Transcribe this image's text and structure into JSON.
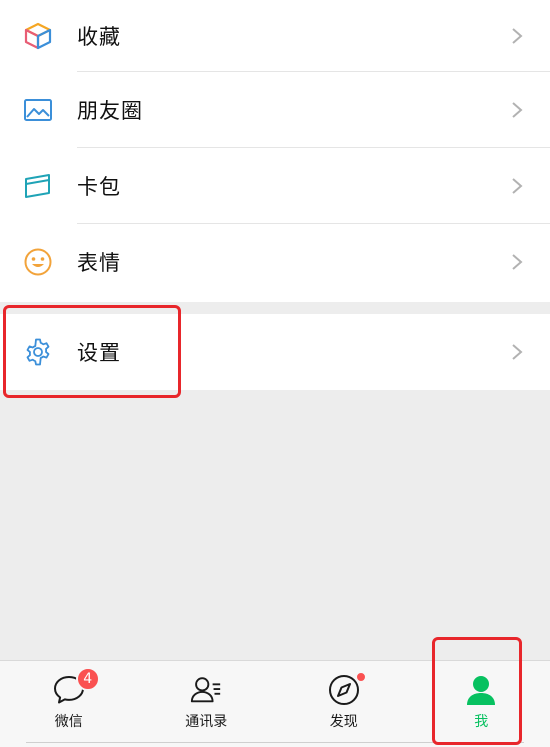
{
  "menu": {
    "items": [
      {
        "label": "收藏",
        "icon": "favorites-cube-icon"
      },
      {
        "label": "朋友圈",
        "icon": "moments-picture-icon"
      },
      {
        "label": "卡包",
        "icon": "card-wallet-icon"
      },
      {
        "label": "表情",
        "icon": "sticker-smiley-icon"
      }
    ],
    "settings": {
      "label": "设置",
      "icon": "settings-gear-icon"
    }
  },
  "tabbar": {
    "tabs": [
      {
        "label": "微信",
        "badge": "4",
        "icon": "chat-bubble-icon"
      },
      {
        "label": "通讯录",
        "icon": "contacts-icon"
      },
      {
        "label": "发现",
        "icon": "discover-compass-icon",
        "has_dot": true
      },
      {
        "label": "我",
        "icon": "me-person-icon",
        "active": true
      }
    ]
  },
  "colors": {
    "accent_green": "#07c160",
    "badge_red": "#fa5151",
    "annotation_red": "#e8262b",
    "background": "#ededed"
  }
}
